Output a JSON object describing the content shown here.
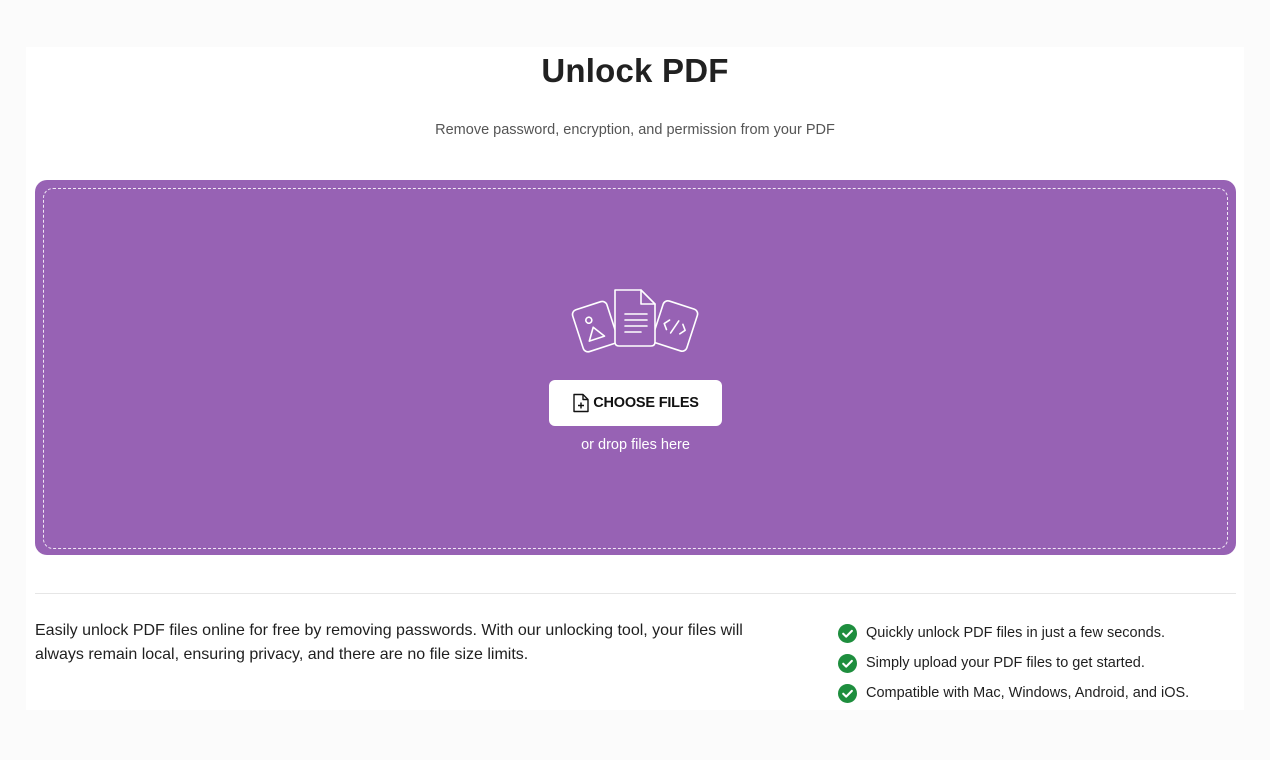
{
  "header": {
    "title": "Unlock PDF",
    "subtitle": "Remove password, encryption, and permission from your PDF"
  },
  "dropzone": {
    "background_color": "#9762b4",
    "illustration_icon": "files-illustration-icon",
    "choose_button": {
      "label": "CHOOSE FILES",
      "icon": "file-add-icon"
    },
    "hint": "or drop files here"
  },
  "info": {
    "description": "Easily unlock PDF files online for free by removing passwords. With our unlocking tool, your files will always remain local, ensuring privacy, and there are no file size limits.",
    "features": [
      {
        "text": "Quickly unlock PDF files in just a few seconds.",
        "icon": "check-circle-icon"
      },
      {
        "text": "Simply upload your PDF files to get started.",
        "icon": "check-circle-icon"
      },
      {
        "text": "Compatible with Mac, Windows, Android, and iOS.",
        "icon": "check-circle-icon"
      }
    ],
    "check_color": "#1e8e3e"
  }
}
